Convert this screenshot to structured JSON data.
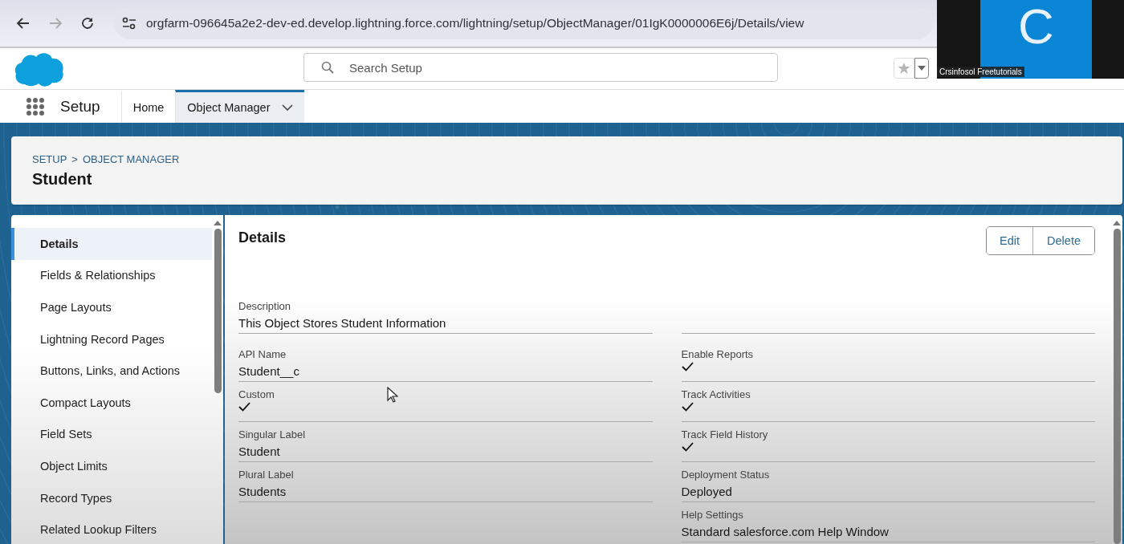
{
  "browser": {
    "url": "orgfarm-096645a2e2-dev-ed.develop.lightning.force.com/lightning/setup/ObjectManager/01IgK0000006E6j/Details/view"
  },
  "video_overlay": {
    "initial": "C",
    "name": "Crsinfosol Freetutorials"
  },
  "header": {
    "search": {
      "placeholder": "Search Setup"
    }
  },
  "nav": {
    "app_name": "Setup",
    "tabs": [
      {
        "label": "Home",
        "selected": false,
        "has_menu": false
      },
      {
        "label": "Object Manager",
        "selected": true,
        "has_menu": true
      }
    ]
  },
  "page_header": {
    "breadcrumbs": [
      "SETUP",
      "OBJECT MANAGER"
    ],
    "separator": ">",
    "title": "Student"
  },
  "sidebar": {
    "items": [
      {
        "label": "Details",
        "selected": true
      },
      {
        "label": "Fields & Relationships",
        "selected": false
      },
      {
        "label": "Page Layouts",
        "selected": false
      },
      {
        "label": "Lightning Record Pages",
        "selected": false
      },
      {
        "label": "Buttons, Links, and Actions",
        "selected": false
      },
      {
        "label": "Compact Layouts",
        "selected": false
      },
      {
        "label": "Field Sets",
        "selected": false
      },
      {
        "label": "Object Limits",
        "selected": false
      },
      {
        "label": "Record Types",
        "selected": false
      },
      {
        "label": "Related Lookup Filters",
        "selected": false
      }
    ]
  },
  "details": {
    "title": "Details",
    "buttons": [
      "Edit",
      "Delete"
    ],
    "description": {
      "label": "Description",
      "value": "This Object Stores Student Information"
    },
    "columns": [
      [
        {
          "kind": "text",
          "label": "API Name",
          "value": "Student__c"
        },
        {
          "kind": "check",
          "label": "Custom",
          "checked": true
        },
        {
          "kind": "text",
          "label": "Singular Label",
          "value": "Student"
        },
        {
          "kind": "text",
          "label": "Plural Label",
          "value": "Students"
        }
      ],
      [
        {
          "kind": "check",
          "label": "Enable Reports",
          "checked": true
        },
        {
          "kind": "check",
          "label": "Track Activities",
          "checked": true
        },
        {
          "kind": "check",
          "label": "Track Field History",
          "checked": true
        },
        {
          "kind": "text",
          "label": "Deployment Status",
          "value": "Deployed"
        },
        {
          "kind": "text",
          "label": "Help Settings",
          "value": "Standard salesforce.com Help Window"
        }
      ]
    ]
  }
}
